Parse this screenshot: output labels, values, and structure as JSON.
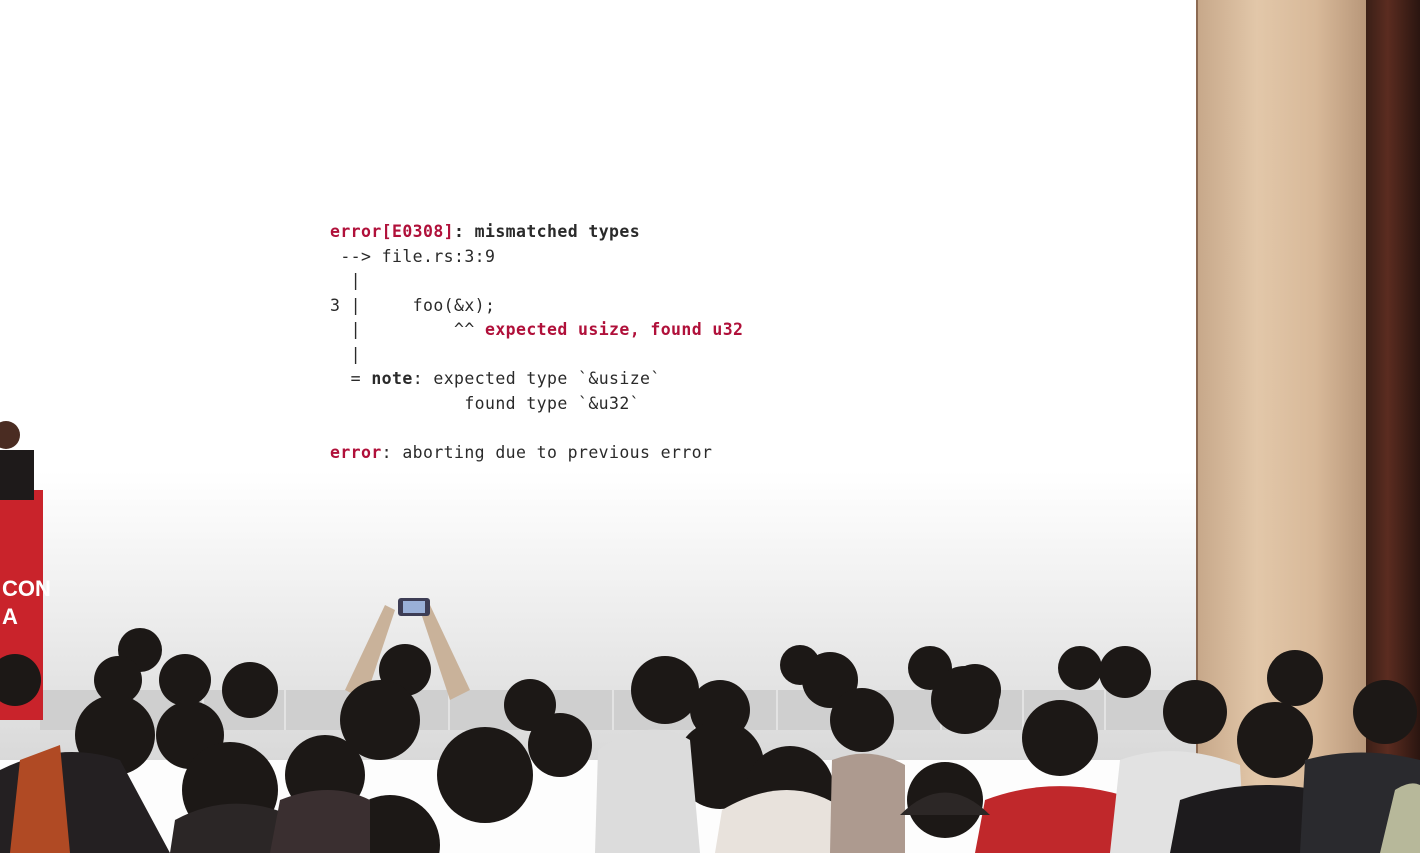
{
  "slide": {
    "lines": [
      {
        "parts": [
          {
            "text": "error[E0308]",
            "style": "err"
          },
          {
            "text": ": mismatched types",
            "style": "bold"
          }
        ]
      },
      {
        "parts": [
          {
            "text": " --> file.rs:3:9",
            "style": ""
          }
        ]
      },
      {
        "parts": [
          {
            "text": "  |",
            "style": ""
          }
        ]
      },
      {
        "parts": [
          {
            "text": "3 |     foo(&x);",
            "style": ""
          }
        ]
      },
      {
        "parts": [
          {
            "text": "  |         ^^ ",
            "style": ""
          },
          {
            "text": "expected usize, found u32",
            "style": "err"
          }
        ]
      },
      {
        "parts": [
          {
            "text": "  |",
            "style": ""
          }
        ]
      },
      {
        "parts": [
          {
            "text": "  = ",
            "style": ""
          },
          {
            "text": "note",
            "style": "bold"
          },
          {
            "text": ": expected type `&usize`",
            "style": ""
          }
        ]
      },
      {
        "parts": [
          {
            "text": "             found type `&u32`",
            "style": ""
          }
        ]
      },
      {
        "parts": [
          {
            "text": "",
            "style": ""
          }
        ]
      },
      {
        "parts": [
          {
            "text": "error",
            "style": "err"
          },
          {
            "text": ": aborting due to previous error",
            "style": ""
          }
        ]
      }
    ]
  },
  "podium": {
    "line1": "CON",
    "line2": "A"
  },
  "colors": {
    "error_red": "#b0103a",
    "podium_red": "#c9232b",
    "pillar": "#dcc1a3"
  }
}
